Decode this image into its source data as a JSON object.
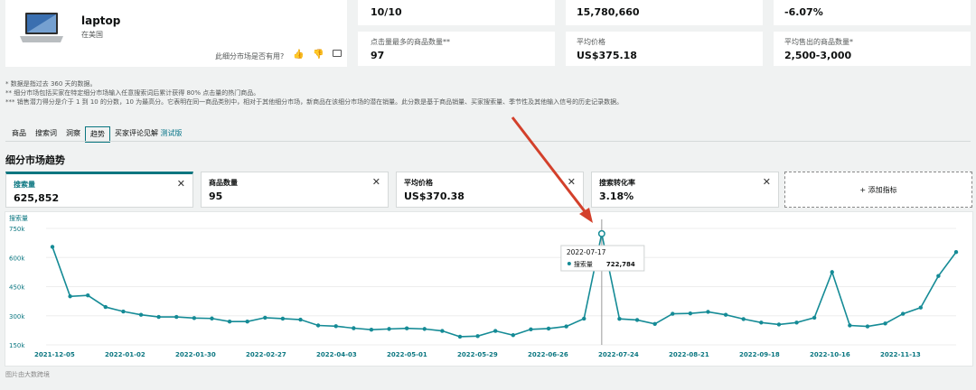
{
  "product": {
    "name": "laptop",
    "region": "在美国",
    "feedback": "此细分市场是否有用?"
  },
  "stats_top": [
    {
      "label": "",
      "value": "10/10"
    },
    {
      "label": "",
      "value": "15,780,660"
    },
    {
      "label": "",
      "value": "-6.07%"
    }
  ],
  "stats_bottom": [
    {
      "label": "点击量最多的商品数量**",
      "value": "97"
    },
    {
      "label": "平均价格",
      "value": "US$375.18"
    },
    {
      "label": "平均售出的商品数量*",
      "value": "2,500-3,000"
    }
  ],
  "notes": [
    "* 数据是指过去 360 天的数据。",
    "** 细分市场包括买家在特定细分市场输入任意搜索词后累计获得 80% 点击量的热门商品。",
    "*** 销售潜力得分是介于 1 到 10 的分数，10 为最高分。它表明在同一商品类别中，相对于其他细分市场，新商品在该细分市场的潜在销量。此分数是基于商品销量、买家搜索量、季节性及其他输入信号的历史记录数据。"
  ],
  "tabs": [
    {
      "label": "商品"
    },
    {
      "label": "搜索词"
    },
    {
      "label": "洞察"
    },
    {
      "label": "趋势"
    },
    {
      "label": "买家评论见解"
    }
  ],
  "tab_beta": "测试版",
  "section_title": "细分市场趋势",
  "metrics": [
    {
      "label": "搜索量",
      "value": "625,852"
    },
    {
      "label": "商品数量",
      "value": "95"
    },
    {
      "label": "平均价格",
      "value": "US$370.38"
    },
    {
      "label": "搜索转化率",
      "value": "3.18%"
    }
  ],
  "add_metric": "+ 添加指标",
  "chart_data": {
    "type": "line",
    "ylabel": "搜索量",
    "yticks": [
      "750k",
      "600k",
      "450k",
      "300k",
      "150k"
    ],
    "ylim": [
      150000,
      750000
    ],
    "xticks": [
      "2021-12-05",
      "2022-01-02",
      "2022-01-30",
      "2022-02-27",
      "2022-04-03",
      "2022-05-01",
      "2022-05-29",
      "2022-06-26",
      "2022-07-24",
      "2022-08-21",
      "2022-09-18",
      "2022-10-16",
      "2022-11-13"
    ],
    "series": [
      {
        "name": "搜索量",
        "color": "#158b96",
        "values": [
          655000,
          400000,
          405000,
          345000,
          322000,
          305000,
          294000,
          294000,
          288000,
          286000,
          270000,
          270000,
          290000,
          285000,
          280000,
          250000,
          246000,
          236000,
          228000,
          232000,
          235000,
          232000,
          222000,
          192000,
          195000,
          222000,
          200000,
          230000,
          234000,
          245000,
          285000,
          722784,
          284000,
          278000,
          258000,
          310000,
          312000,
          320000,
          305000,
          283000,
          265000,
          255000,
          265000,
          290000,
          525000,
          250000,
          245000,
          260000,
          310000,
          342000,
          505000,
          628000
        ]
      }
    ],
    "tooltip": {
      "date": "2022-07-17",
      "series": "搜索量",
      "value": "722,784",
      "index": 31
    }
  },
  "footer_text": "图片由大数跨境"
}
